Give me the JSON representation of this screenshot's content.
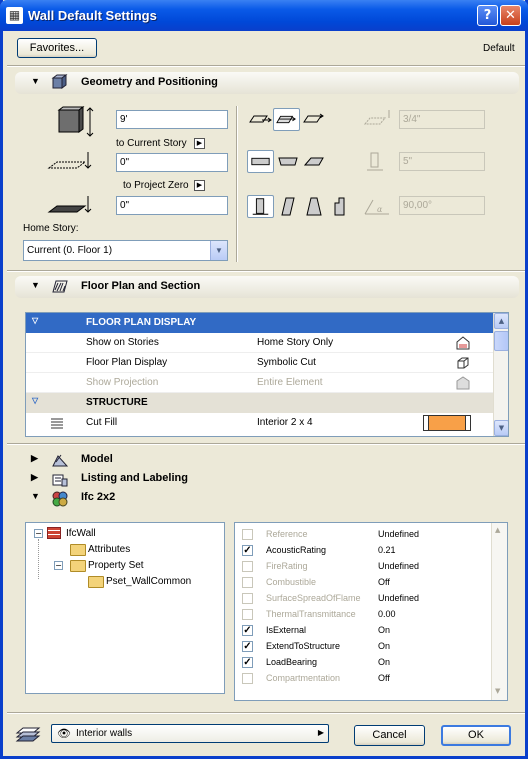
{
  "window": {
    "title": "Wall Default Settings",
    "help_glyph": "?",
    "close_glyph": "✕"
  },
  "top": {
    "favorites_label": "Favorites...",
    "default_label": "Default"
  },
  "sections": {
    "geometry": "Geometry and Positioning",
    "floor_plan": "Floor Plan and Section",
    "model": "Model",
    "listing": "Listing and Labeling",
    "ifc": "Ifc 2x2"
  },
  "geometry": {
    "height_value": "9'",
    "to_current_story_label": "to Current Story",
    "current_story_offset": "0\"",
    "to_project_zero_label": "to Project Zero",
    "project_zero_offset": "0\"",
    "home_story_label": "Home Story:",
    "home_story_value": "Current (0. Floor 1)",
    "thickness_value": "3/4\"",
    "offset_value": "5\"",
    "angle_value": "90,00°"
  },
  "floor_plan_table": {
    "group1": "FLOOR PLAN DISPLAY",
    "rows1": [
      {
        "name": "Show on Stories",
        "value": "Home Story Only",
        "dim": false
      },
      {
        "name": "Floor Plan Display",
        "value": "Symbolic Cut",
        "dim": false
      },
      {
        "name": "Show Projection",
        "value": "Entire Element",
        "dim": true
      }
    ],
    "group2": "STRUCTURE",
    "rows2": [
      {
        "name": "Cut Fill",
        "value": "Interior 2 x 4"
      }
    ]
  },
  "ifc_tree": {
    "root": "IfcWall",
    "attributes": "Attributes",
    "property_set": "Property Set",
    "pset": "Pset_WallCommon"
  },
  "ifc_props": [
    {
      "name": "Reference",
      "value": "Undefined",
      "checked": false,
      "dim": true
    },
    {
      "name": "AcousticRating",
      "value": "0.21",
      "checked": true,
      "dim": false
    },
    {
      "name": "FireRating",
      "value": "Undefined",
      "checked": false,
      "dim": true
    },
    {
      "name": "Combustible",
      "value": "Off",
      "checked": false,
      "dim": true
    },
    {
      "name": "SurfaceSpreadOfFlame",
      "value": "Undefined",
      "checked": false,
      "dim": true
    },
    {
      "name": "ThermalTransmittance",
      "value": "0.00",
      "checked": false,
      "dim": true
    },
    {
      "name": "IsExternal",
      "value": "On",
      "checked": true,
      "dim": false
    },
    {
      "name": "ExtendToStructure",
      "value": "On",
      "checked": true,
      "dim": false
    },
    {
      "name": "LoadBearing",
      "value": "On",
      "checked": true,
      "dim": false
    },
    {
      "name": "Compartmentation",
      "value": "Off",
      "checked": false,
      "dim": true
    }
  ],
  "bottom": {
    "layer_value": "Interior walls",
    "cancel_label": "Cancel",
    "ok_label": "OK"
  },
  "colors": {
    "accent": "#316ac5",
    "cut_fill": "#f8a048",
    "title_blue": "#0a5ae8"
  }
}
